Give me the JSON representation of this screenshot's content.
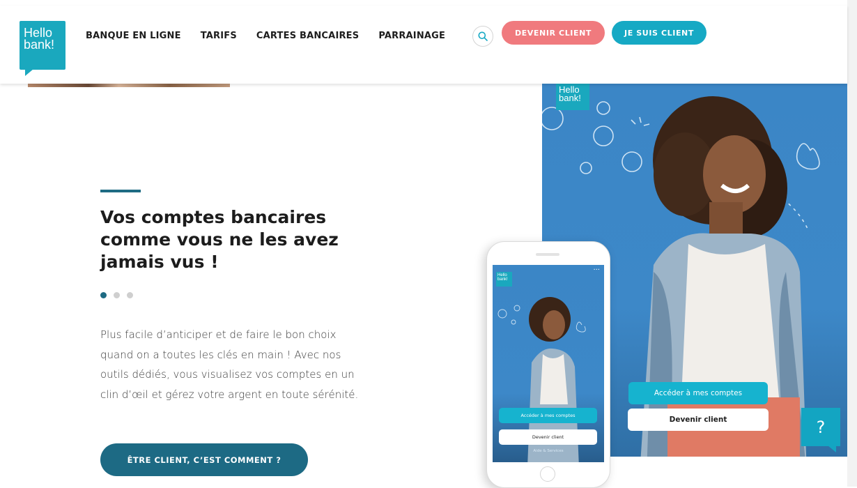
{
  "brand": {
    "logo_line1": "Hello",
    "logo_line2": "bank!",
    "accent": "#1aa8be"
  },
  "nav": {
    "items": [
      {
        "label": "BANQUE EN LIGNE"
      },
      {
        "label": "TARIFS"
      },
      {
        "label": "CARTES BANCAIRES"
      },
      {
        "label": "PARRAINAGE"
      }
    ],
    "search_icon": "search-icon",
    "become_client": "DEVENIR CLIENT",
    "i_am_client": "JE SUIS CLIENT"
  },
  "hero": {
    "title": "Vos comptes bancaires comme vous ne les avez jamais vus !",
    "carousel": {
      "slides": 3,
      "active": 1
    },
    "body": "Plus facile d’anticiper et de faire le bon choix quand on a toutes les clés en main ! Avec nos outils dédiés, vous visualisez vos comptes en un clin d’œil et gérez votre argent en toute sérénité.",
    "cta": "ÊTRE CLIENT, C’EST COMMENT ?"
  },
  "visual": {
    "primary_button": "Accéder à mes comptes",
    "secondary_button": "Devenir client",
    "phone": {
      "logo_line1": "Hello",
      "logo_line2": "bank!",
      "primary_button": "Accéder à mes comptes",
      "secondary_button": "Devenir client",
      "footer": "Aide & Services"
    }
  },
  "help": {
    "label": "?"
  },
  "colors": {
    "coral": "#f07a7e",
    "cyan": "#16a9c4",
    "teal_dark": "#1d6a84",
    "sky": "#3b86c6"
  }
}
